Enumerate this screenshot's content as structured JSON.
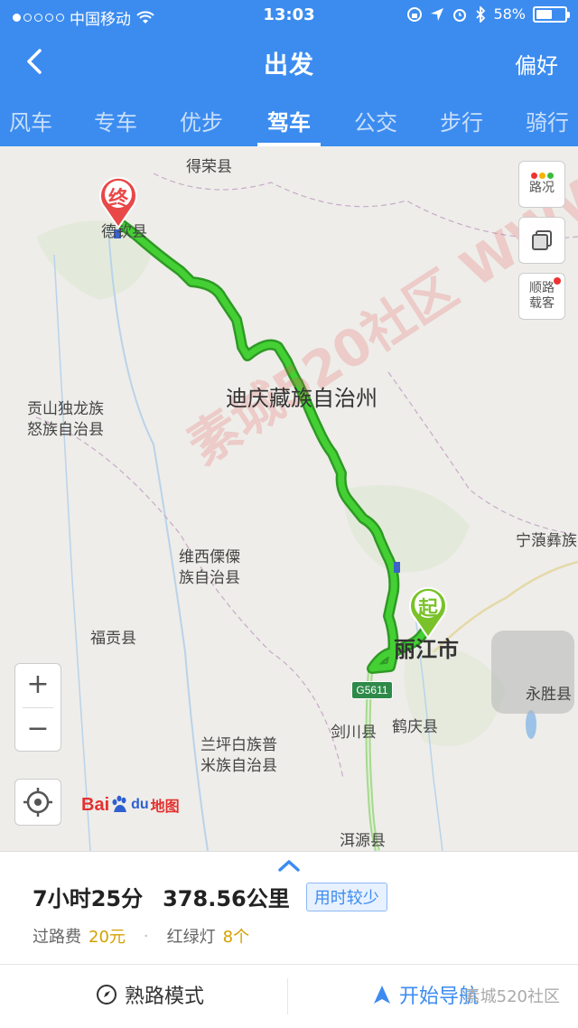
{
  "status_bar": {
    "carrier": "中国移动",
    "time": "13:03",
    "battery": "58%",
    "battery_level": 0.58
  },
  "nav": {
    "title": "出发",
    "right_label": "偏好",
    "back_icon": "back-chevron-icon"
  },
  "tabs": [
    {
      "label": "风车"
    },
    {
      "label": "专车"
    },
    {
      "label": "优步"
    },
    {
      "label": "驾车",
      "active": true
    },
    {
      "label": "公交"
    },
    {
      "label": "步行"
    },
    {
      "label": "骑行"
    }
  ],
  "map": {
    "labels": {
      "deqin": "德钦县",
      "derong": "得荣县",
      "diqing_line": "迪庆藏族自治州",
      "gongshan_line1": "贡山独龙族",
      "gongshan_line2": "怒族自治县",
      "ninglang": "宁蒗彝族",
      "weixi_line1": "维西傈僳",
      "weixi_line2": "族自治县",
      "fugong": "福贡县",
      "lijiang": "丽江市",
      "yongsheng": "永胜县",
      "jianchuan": "剑川县",
      "heqing": "鹤庆县",
      "lanping_line1": "兰坪白族普",
      "lanping_line2": "米族自治县",
      "eryuan": "洱源县"
    },
    "road_shield": "G5611",
    "start_pin": "起",
    "end_pin": "终",
    "controls": {
      "traffic": "路况",
      "carpool_line1": "顺路",
      "carpool_line2": "载客",
      "zoom_in": "+",
      "zoom_out": "−"
    },
    "logo": {
      "bai": "Bai",
      "du": "du",
      "map": "地图"
    },
    "watermark": "素城520社区 WWW.SC520.CN"
  },
  "route": {
    "duration": "7小时25分",
    "distance": "378.56公里",
    "badge": "用时较少",
    "toll_label": "过路费",
    "toll_value": "20元",
    "lights_label": "红绿灯",
    "lights_value": "8个",
    "familiar_mode": "熟路模式",
    "start_nav": "开始导航",
    "corner_mark": "素城520社区"
  },
  "colors": {
    "primary": "#3c8cf0",
    "route_green": "#3ecb2c",
    "end_pin": "#e94848",
    "start_pin": "#7ac22a"
  }
}
